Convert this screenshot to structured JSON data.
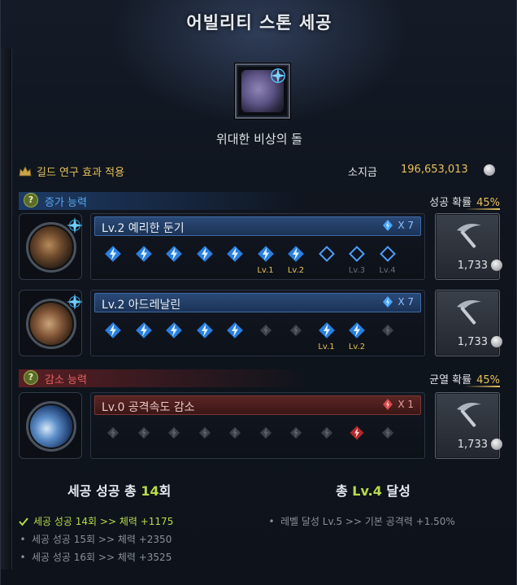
{
  "title": "어빌리티 스톤 세공",
  "stone": {
    "name": "위대한 비상의 돌"
  },
  "guild_label": "길드 연구 효과 적용",
  "gold": {
    "label": "소지금",
    "value": "196,653,013"
  },
  "increase": {
    "label": "증가 능력",
    "rate_label": "성공 확률",
    "rate_value": "45%"
  },
  "decrease": {
    "label": "감소 능력",
    "rate_label": "균열 확률",
    "rate_value": "45%"
  },
  "help_glyph": "?",
  "abilities": [
    {
      "name": "Lv.2 예리한 둔기",
      "count": "X 7",
      "cost": "1,733",
      "slots": [
        "success",
        "success",
        "success",
        "success",
        "success",
        "success",
        "success",
        "empty",
        "empty",
        "empty"
      ],
      "slot_labels": [
        "",
        "",
        "",
        "",
        "",
        "Lv.1",
        "Lv.2",
        "",
        "Lv.3",
        "Lv.4"
      ]
    },
    {
      "name": "Lv.2 아드레날린",
      "count": "X 7",
      "cost": "1,733",
      "slots": [
        "success",
        "success",
        "success",
        "success",
        "success",
        "pending",
        "pending",
        "success",
        "success",
        "pending"
      ],
      "slot_labels": [
        "",
        "",
        "",
        "",
        "",
        "",
        "",
        "Lv.1",
        "Lv.2",
        ""
      ]
    },
    {
      "name": "Lv.0 공격속도 감소",
      "count": "X 1",
      "cost": "1,733",
      "slots": [
        "pending",
        "pending",
        "pending",
        "pending",
        "pending",
        "pending",
        "pending",
        "pending",
        "red",
        "pending"
      ],
      "slot_labels": [
        "",
        "",
        "",
        "",
        "",
        "",
        "",
        "",
        "",
        ""
      ]
    }
  ],
  "summary_left": {
    "prefix": "세공 성공 총 ",
    "count": "14",
    "suffix": "회"
  },
  "summary_right": {
    "prefix": "총 ",
    "level": "Lv.4",
    "suffix": " 달성"
  },
  "success_rewards": [
    {
      "text": "세공 성공 14회 >> 체력 +1175",
      "active": true
    },
    {
      "text": "세공 성공 15회 >> 체력 +2350",
      "active": false
    },
    {
      "text": "세공 성공 16회 >> 체력 +3525",
      "active": false
    }
  ],
  "level_rewards": [
    {
      "text": "레벨 달성 Lv.5 >> 기본 공격력 +1.50%",
      "active": false
    }
  ],
  "colors": {
    "gold": "#e7c25a",
    "blue_accent": "#5aa9ee",
    "red_accent": "#e36060",
    "green": "#b7dc4a"
  }
}
